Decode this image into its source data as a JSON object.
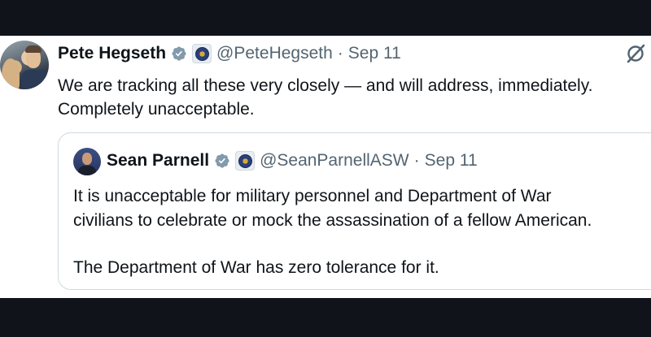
{
  "tweet": {
    "author_name": "Pete Hegseth",
    "author_handle": "@PeteHegseth",
    "separator": "·",
    "date": "Sep 11",
    "text_line1": "We are tracking all these very closely — and will address, immediately.",
    "text_line2": "Completely unacceptable."
  },
  "quoted_tweet": {
    "author_name": "Sean Parnell",
    "author_handle": "@SeanParnellASW",
    "separator": "·",
    "date": "Sep 11",
    "paragraph1_line1": "It is unacceptable for military personnel and Department of War",
    "paragraph1_line2": "civilians to celebrate or mock the assassination of a fellow American.",
    "paragraph2": "The Department of War has zero tolerance for it."
  },
  "icons": {
    "verified": "verified-badge-icon",
    "affiliation": "department-seal-icon",
    "platform": "x-logo-icon"
  },
  "colors": {
    "verified": "#829aab",
    "secondary_text": "#536471",
    "primary_text": "#0f1419",
    "border": "#cfd9de",
    "background": "#11131a"
  }
}
